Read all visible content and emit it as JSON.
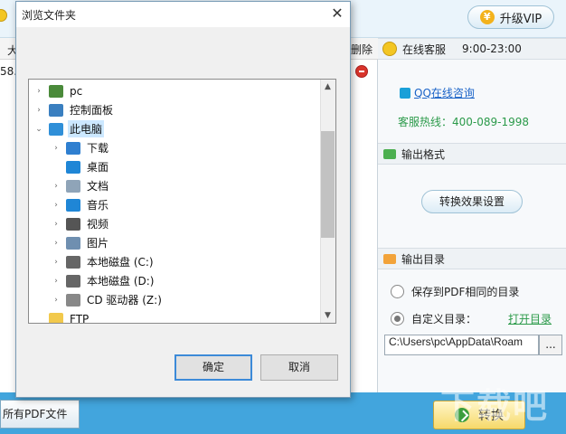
{
  "app": {
    "vip_label": "升级VIP",
    "vip_icon_glyph": "¥",
    "left_column_letter": "大",
    "delete_label": "删除",
    "row_number": "58.",
    "all_pdf_label": "所有PDF文件",
    "convert_label": "转换",
    "watermark": "下载吧"
  },
  "customer_service": {
    "title": "在线客服",
    "hours": "9:00-23:00",
    "qq_link": "QQ在线咨询",
    "hotline": "客服热线：400-089-1998"
  },
  "output_format": {
    "title": "输出格式",
    "effect_button": "转换效果设置"
  },
  "output_dir": {
    "title": "输出目录",
    "option_same": "保存到PDF相同的目录",
    "option_custom": "自定义目录：",
    "open_dir_link": "打开目录",
    "path_value": "C:\\Users\\pc\\AppData\\Roam",
    "browse_label": "..."
  },
  "dialog": {
    "title": "浏览文件夹",
    "close_glyph": "✕",
    "ok_label": "确定",
    "cancel_label": "取消",
    "tree": [
      {
        "label": "pc",
        "icon": "user-icon",
        "color": "#4a8a3a"
      },
      {
        "label": "控制面板",
        "icon": "control-panel-icon",
        "color": "#3a7fc0"
      },
      {
        "label": "此电脑",
        "icon": "computer-icon",
        "color": "#2f8fd8",
        "selected": true
      },
      {
        "label": "下载",
        "icon": "download-icon",
        "color": "#2f7fd0"
      },
      {
        "label": "桌面",
        "icon": "desktop-icon",
        "color": "#1f86d6"
      },
      {
        "label": "文档",
        "icon": "document-icon",
        "color": "#8fa4b8"
      },
      {
        "label": "音乐",
        "icon": "music-icon",
        "color": "#1f86d6"
      },
      {
        "label": "视频",
        "icon": "video-icon",
        "color": "#555555"
      },
      {
        "label": "图片",
        "icon": "picture-icon",
        "color": "#6f8fb0"
      },
      {
        "label": "本地磁盘 (C:)",
        "icon": "drive-c-icon",
        "color": "#666666"
      },
      {
        "label": "本地磁盘 (D:)",
        "icon": "drive-d-icon",
        "color": "#666666"
      },
      {
        "label": "CD 驱动器 (Z:)",
        "icon": "cd-drive-icon",
        "color": "#888888"
      },
      {
        "label": "FTP",
        "icon": "folder-icon",
        "color": "#f2c94c"
      }
    ]
  },
  "colors": {
    "accent_blue": "#42a5dd",
    "link_green": "#2b9a4a",
    "link_blue": "#1b64c8",
    "selection": "#cce8ff"
  }
}
